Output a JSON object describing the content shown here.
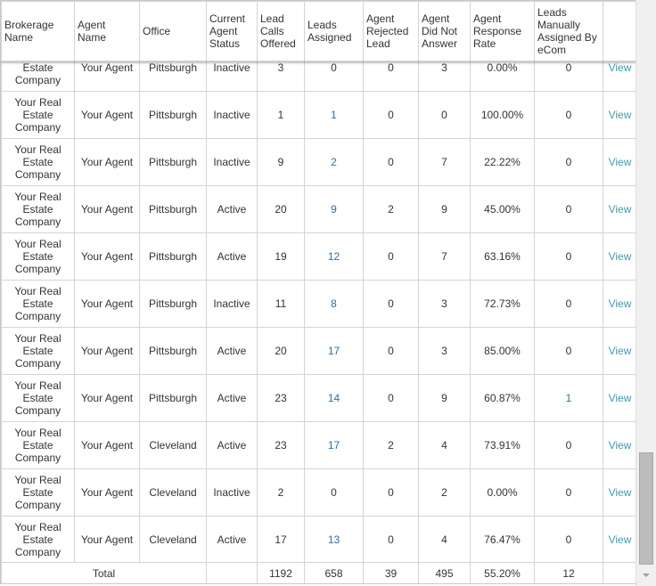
{
  "headers": [
    "Brokerage Name",
    "Agent Name",
    "Office",
    "Current Agent Status",
    "Lead Calls Offered",
    "Leads Assigned",
    "Agent Rejected Lead",
    "Agent Did Not Answer",
    "Agent Response Rate",
    "Leads Manually Assigned By eCom",
    ""
  ],
  "view_label": "View",
  "rows": [
    [
      "Your Real Estate Company",
      "Your Agent",
      "Pittsburgh",
      "Inactive",
      "3",
      "0",
      "0",
      "3",
      "0.00%",
      "0"
    ],
    [
      "Your Real Estate Company",
      "Your Agent",
      "Pittsburgh",
      "Inactive",
      "1",
      "1",
      "0",
      "0",
      "100.00%",
      "0"
    ],
    [
      "Your Real Estate Company",
      "Your Agent",
      "Pittsburgh",
      "Inactive",
      "9",
      "2",
      "0",
      "7",
      "22.22%",
      "0"
    ],
    [
      "Your Real Estate Company",
      "Your Agent",
      "Pittsburgh",
      "Active",
      "20",
      "9",
      "2",
      "9",
      "45.00%",
      "0"
    ],
    [
      "Your Real Estate Company",
      "Your Agent",
      "Pittsburgh",
      "Active",
      "19",
      "12",
      "0",
      "7",
      "63.16%",
      "0"
    ],
    [
      "Your Real Estate Company",
      "Your Agent",
      "Pittsburgh",
      "Inactive",
      "11",
      "8",
      "0",
      "3",
      "72.73%",
      "0"
    ],
    [
      "Your Real Estate Company",
      "Your Agent",
      "Pittsburgh",
      "Active",
      "20",
      "17",
      "0",
      "3",
      "85.00%",
      "0"
    ],
    [
      "Your Real Estate Company",
      "Your Agent",
      "Pittsburgh",
      "Active",
      "23",
      "14",
      "0",
      "9",
      "60.87%",
      "1"
    ],
    [
      "Your Real Estate Company",
      "Your Agent",
      "Cleveland",
      "Active",
      "23",
      "17",
      "2",
      "4",
      "73.91%",
      "0"
    ],
    [
      "Your Real Estate Company",
      "Your Agent",
      "Cleveland",
      "Inactive",
      "2",
      "0",
      "0",
      "2",
      "0.00%",
      "0"
    ],
    [
      "Your Real Estate Company",
      "Your Agent",
      "Cleveland",
      "Active",
      "17",
      "13",
      "0",
      "4",
      "76.47%",
      "0"
    ]
  ],
  "total": {
    "label": "Total",
    "calls": "1192",
    "assigned": "658",
    "rejected": "39",
    "dna": "495",
    "rate": "55.20%",
    "manual": "12"
  },
  "colors": {
    "link": "#3a9eb0",
    "border": "#d4d4d4"
  }
}
